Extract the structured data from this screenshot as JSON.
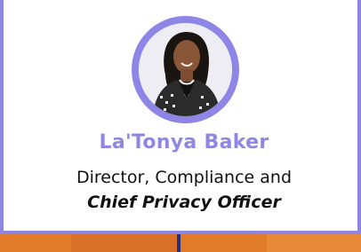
{
  "profile": {
    "name": "La'Tonya Baker",
    "title_line1": "Director, Compliance and",
    "title_line2": "Chief Privacy Officer"
  },
  "colors": {
    "accent": "#8d86e6",
    "name_text": "#8f88e2",
    "footer_band": "#e07b2a",
    "footer_divider": "#2a2f7a"
  },
  "icons": {
    "avatar": "profile-photo"
  }
}
